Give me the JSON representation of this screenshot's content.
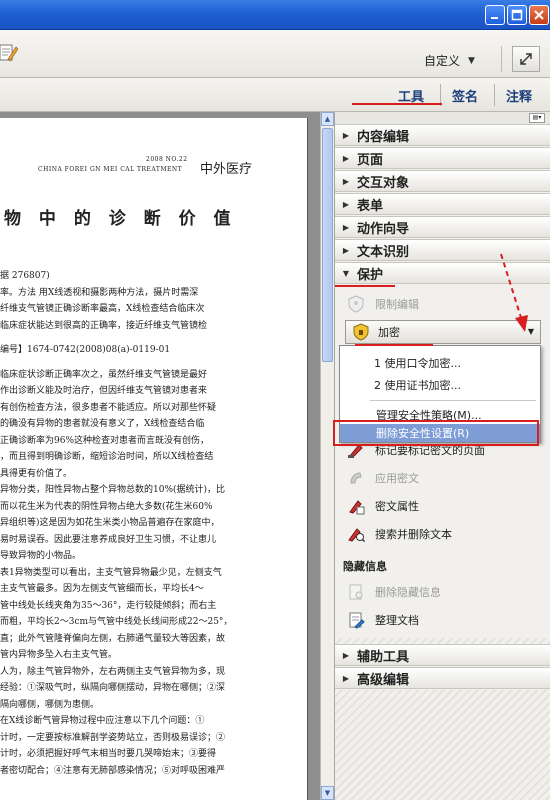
{
  "toolbar": {
    "customize_label": "自定义",
    "customize_arrow": "▼"
  },
  "tabs": [
    {
      "label": "工具"
    },
    {
      "label": "签名"
    },
    {
      "label": "注释"
    }
  ],
  "document": {
    "journal_en": "CHINA FOREI GN MEI CAL TREATMENT",
    "journal_year": "2008  NO.22",
    "journal_cn": "中外医疗",
    "title": "物 中 的 诊 断 价 值",
    "lines": [
      "据    276807)",
      "率。方法  用X线透视和摄影两种方法，摄片时需深",
      "纤维支气管镜正确诊断率最高，X线检查结合临床次",
      "临床症状能达到很高的正确率，接近纤维支气管镜检",
      "",
      "编号】1674-0742(2008)08(a)-0119-01",
      "",
      "临床症状诊断正确率次之，虽然纤维支气管镜是最好",
      "作出诊断义能及时治疗，但因纤维支气管镜对患者来",
      "有创伤检查方法，很多患者不能适应。所以对那些怀疑",
      "的确没有异物的患者就没有意义了，X线检查结合临",
      "正确诊断率为96%这种检查对患者而言既没有创伤，",
      "，而且得到明确诊断，缩短诊治时间，所以X线检查结",
      "具得更有价值了。",
      "异物分类，阳性异物占整个异物总数的10%(据统计)，比",
      "而以花生米为代表的阴性异物占绝大多数(花生米60%",
      "异组织等)这是因为如花生米类小物品普遍存在家庭中，",
      "易时易误吞。因此要注意养成良好卫生习惯，不让患儿",
      "导致异物的小物品。",
      "表1异物类型可以看出，主支气管异物最少见，左侧支气",
      "主支气管最多。因为左侧支气管细而长，平均长4～",
      "管中线处长线夹角为35～36°，走行较陡倾斜；而右主",
      "而粗，平均长2～3cm与气管中线处长线间形成22～25°，",
      "直；此外气管隆脊偏向左侧，右肺通气量较大等因素，故",
      "管内异物多坠入右主支气管。",
      "人为，除主气管异物外，左右两侧主支气管异物为多，现",
      "经验：①深吸气时，纵隔向哪侧摆动，异物在哪侧；②深",
      "隔向哪侧，哪侧为患侧。",
      "在X线诊断气管异物过程中应注意以下几个问题：①",
      "计时，一定要按标准解剖学姿势站立，否则极易误诊；②",
      "计时，必须把握好呼气末相当时要几哭啼始末；③要得",
      "者密切配合；④注意有无肺部感染情况；⑤对呼吸困难严"
    ]
  },
  "panel": {
    "sections_top": [
      {
        "label": "内容编辑",
        "state": "collapsed"
      },
      {
        "label": "页面",
        "state": "collapsed"
      },
      {
        "label": "交互对象",
        "state": "collapsed"
      },
      {
        "label": "表单",
        "state": "collapsed"
      },
      {
        "label": "动作向导",
        "state": "collapsed"
      },
      {
        "label": "文本识别",
        "state": "collapsed"
      },
      {
        "label": "保护",
        "state": "expanded"
      }
    ],
    "restrict_editing": "限制编辑",
    "encrypt": {
      "label": "加密",
      "menu": [
        "1 使用口令加密...",
        "2 使用证书加密...",
        "管理安全性策略(M)...",
        "删除安全性设置(R)"
      ]
    },
    "items": [
      {
        "label": "标记要标记密文的页面",
        "enabled": true
      },
      {
        "label": "应用密文",
        "enabled": false
      },
      {
        "label": "密文属性",
        "enabled": true
      },
      {
        "label": "搜索并删除文本",
        "enabled": true
      }
    ],
    "hidden_info_group": "隐藏信息",
    "hidden_items": [
      {
        "label": "删除隐藏信息",
        "enabled": false
      },
      {
        "label": "整理文档",
        "enabled": true
      }
    ],
    "sections_bottom": [
      {
        "label": "辅助工具",
        "state": "collapsed"
      },
      {
        "label": "高级编辑",
        "state": "collapsed"
      }
    ]
  },
  "colors": {
    "titlebar": "#1f5fd4",
    "annotation_red": "#d81e1e",
    "menu_highlight": "#7e9dd6",
    "tab_text": "#1c3f7a"
  }
}
